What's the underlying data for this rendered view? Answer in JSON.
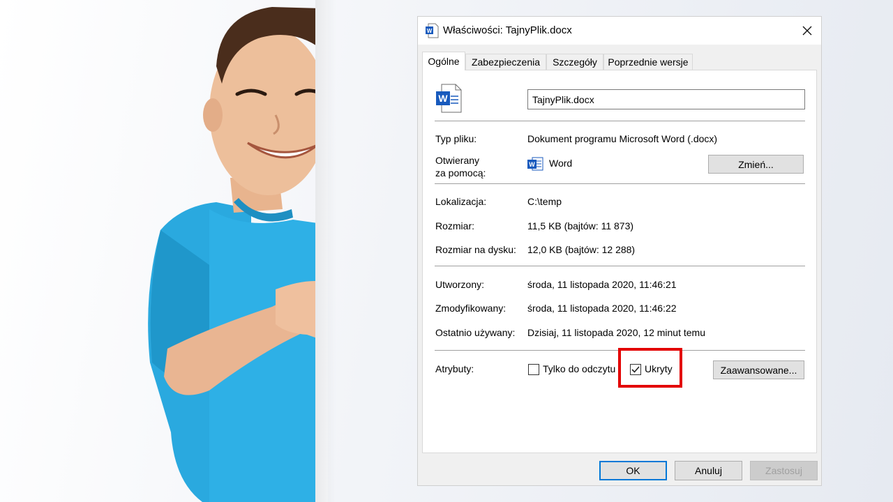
{
  "window": {
    "title": "Właściwości: TajnyPlik.docx",
    "close_glyph": "✕"
  },
  "tabs": [
    {
      "label": "Ogólne",
      "active": true
    },
    {
      "label": "Zabezpieczenia",
      "active": false
    },
    {
      "label": "Szczegóły",
      "active": false
    },
    {
      "label": "Poprzednie wersje",
      "active": false
    }
  ],
  "general": {
    "file_name": "TajnyPlik.docx",
    "file_type_label": "Typ pliku:",
    "file_type_value": "Dokument programu Microsoft Word (.docx)",
    "opens_with_label_1": "Otwierany",
    "opens_with_label_2": "za pomocą:",
    "opens_with_app": "Word",
    "change_button": "Zmień...",
    "location_label": "Lokalizacja:",
    "location_value": "C:\\temp",
    "size_label": "Rozmiar:",
    "size_value": "11,5 KB (bajtów: 11 873)",
    "size_on_disk_label": "Rozmiar na dysku:",
    "size_on_disk_value": "12,0 KB (bajtów: 12 288)",
    "created_label": "Utworzony:",
    "created_value": "środa, 11 listopada 2020, 11:46:21",
    "modified_label": "Zmodyfikowany:",
    "modified_value": "środa, 11 listopada 2020, 11:46:22",
    "accessed_label": "Ostatnio używany:",
    "accessed_value": "Dzisiaj, 11 listopada 2020, 12 minut temu",
    "attributes_label": "Atrybuty:",
    "readonly_label": "Tylko do odczytu",
    "readonly_checked": false,
    "hidden_label": "Ukryty",
    "hidden_checked": true,
    "advanced_button": "Zaawansowane..."
  },
  "footer": {
    "ok": "OK",
    "cancel": "Anuluj",
    "apply": "Zastosuj"
  },
  "colors": {
    "word_blue": "#185abd",
    "highlight_red": "#e30000",
    "focus_blue": "#0078d7",
    "shirt": "#2aa9df"
  }
}
